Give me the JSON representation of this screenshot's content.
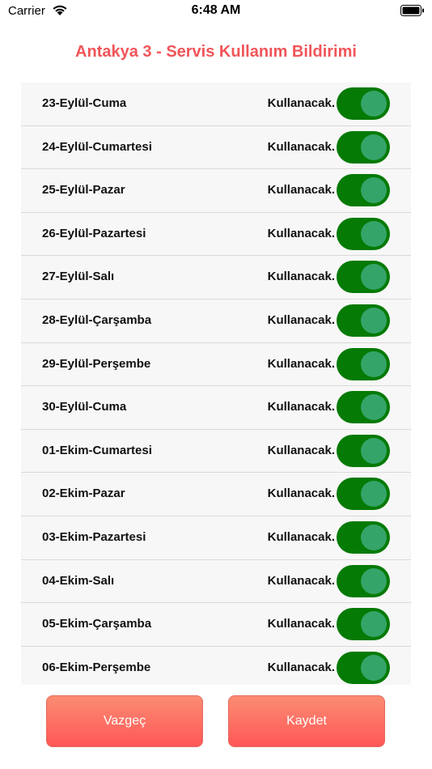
{
  "status_bar": {
    "carrier": "Carrier",
    "time": "6:48 AM"
  },
  "title": "Antakya 3 - Servis Kullanım Bildirimi",
  "rows": [
    {
      "date": "23-Eylül-Cuma",
      "status": "Kullanacak.",
      "enabled": true
    },
    {
      "date": "24-Eylül-Cumartesi",
      "status": "Kullanacak.",
      "enabled": true
    },
    {
      "date": "25-Eylül-Pazar",
      "status": "Kullanacak.",
      "enabled": true
    },
    {
      "date": "26-Eylül-Pazartesi",
      "status": "Kullanacak.",
      "enabled": true
    },
    {
      "date": "27-Eylül-Salı",
      "status": "Kullanacak.",
      "enabled": true
    },
    {
      "date": "28-Eylül-Çarşamba",
      "status": "Kullanacak.",
      "enabled": true
    },
    {
      "date": "29-Eylül-Perşembe",
      "status": "Kullanacak.",
      "enabled": true
    },
    {
      "date": "30-Eylül-Cuma",
      "status": "Kullanacak.",
      "enabled": true
    },
    {
      "date": "01-Ekim-Cumartesi",
      "status": "Kullanacak.",
      "enabled": true
    },
    {
      "date": "02-Ekim-Pazar",
      "status": "Kullanacak.",
      "enabled": true
    },
    {
      "date": "03-Ekim-Pazartesi",
      "status": "Kullanacak.",
      "enabled": true
    },
    {
      "date": "04-Ekim-Salı",
      "status": "Kullanacak.",
      "enabled": true
    },
    {
      "date": "05-Ekim-Çarşamba",
      "status": "Kullanacak.",
      "enabled": true
    },
    {
      "date": "06-Ekim-Perşembe",
      "status": "Kullanacak.",
      "enabled": true
    }
  ],
  "buttons": {
    "cancel": "Vazgeç",
    "save": "Kaydet"
  },
  "colors": {
    "title": "#f0555a",
    "toggle_track": "#057a05",
    "toggle_knob": "#34a468",
    "button": "#ff6b63"
  }
}
